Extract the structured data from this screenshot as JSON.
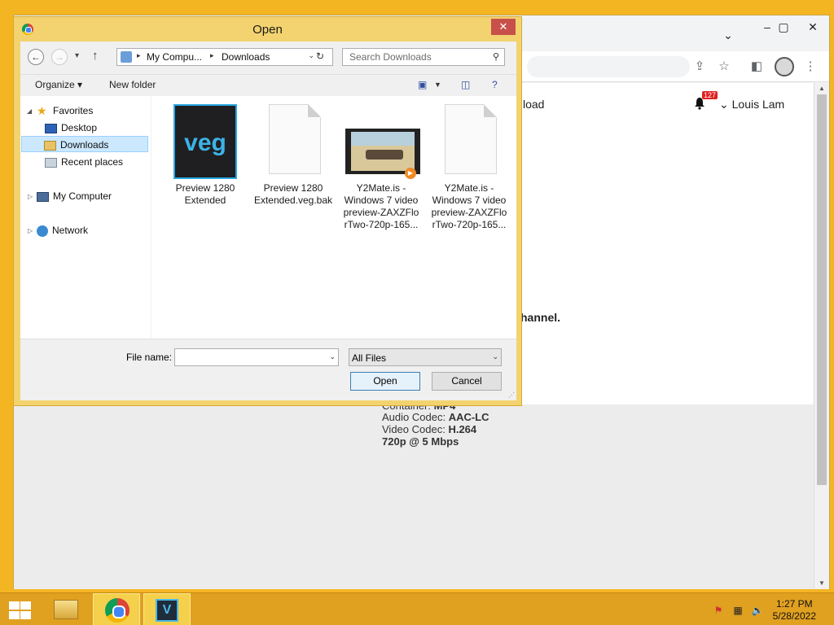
{
  "dialog": {
    "title": "Open",
    "address": {
      "segments": [
        "My Compu...",
        "Downloads"
      ]
    },
    "search": {
      "placeholder": "Search Downloads"
    },
    "commands": {
      "organize": "Organize ▾",
      "new_folder": "New folder"
    },
    "tree": {
      "favorites": "Favorites",
      "desktop": "Desktop",
      "downloads": "Downloads",
      "recent": "Recent places",
      "computer": "My Computer",
      "network": "Network"
    },
    "files": [
      {
        "label": "Preview 1280 Extended",
        "icon": "veg"
      },
      {
        "label": "Preview 1280 Extended.veg.bak",
        "icon": "document"
      },
      {
        "label": "Y2Mate.is - Windows 7 video preview-ZAXZFlo rTwo-720p-165...",
        "icon": "video"
      },
      {
        "label": "Y2Mate.is - Windows 7 video preview-ZAXZFlo rTwo-720p-165...",
        "icon": "document"
      }
    ],
    "veg_icon_text": "veg",
    "file_name": {
      "label": "File name:",
      "value": ""
    },
    "filter": {
      "selected": "All Files"
    },
    "buttons": {
      "open": "Open",
      "cancel": "Cancel"
    },
    "close_glyph": "✕"
  },
  "browser": {
    "page_fragments": {
      "download": "load",
      "channel": "hannel."
    },
    "user_name": "Louis Lam",
    "notification_count": "127",
    "codec": {
      "container_label": "Container:",
      "container_value": "MP4",
      "audio_label": "Audio Codec:",
      "audio_value": "AAC-LC",
      "video_label": "Video Codec:",
      "video_value": "H.264",
      "quality": "720p @ 5 Mbps"
    }
  },
  "taskbar": {
    "vegas_icon_text": "V",
    "time": "1:27 PM",
    "date": "5/28/2022"
  },
  "colors": {
    "desktop": "#f4b522",
    "dialog_frame": "#f3d36f",
    "close_button": "#c7504b",
    "selection": "#cce8ff"
  }
}
